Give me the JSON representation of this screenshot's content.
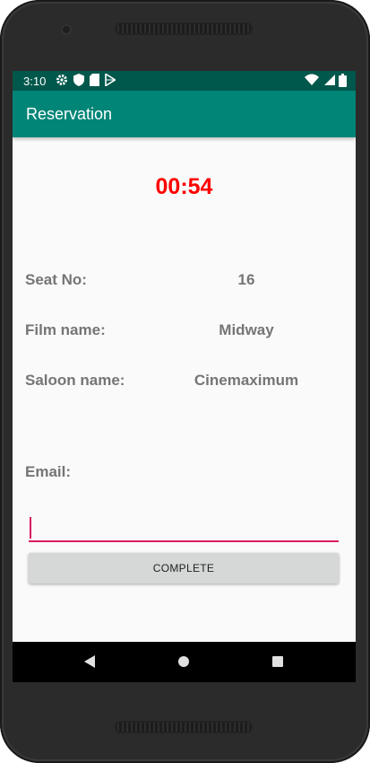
{
  "status_bar": {
    "time": "3:10",
    "icons": [
      "settings-icon",
      "shield-icon",
      "sd-card-icon",
      "play-store-icon"
    ],
    "right_icons": [
      "wifi-icon",
      "signal-icon",
      "battery-icon"
    ]
  },
  "app_bar": {
    "title": "Reservation"
  },
  "timer": {
    "value": "00:54",
    "color": "#ff0000"
  },
  "details": [
    {
      "label": "Seat No:",
      "value": "16"
    },
    {
      "label": "Film name:",
      "value": "Midway"
    },
    {
      "label": "Saloon name:",
      "value": "Cinemaximum"
    }
  ],
  "email": {
    "label": "Email:",
    "value": ""
  },
  "complete_button": {
    "label": "COMPLETE"
  },
  "nav_bar": {
    "icons": [
      "back-icon",
      "home-icon",
      "recents-icon"
    ]
  },
  "colors": {
    "primary": "#008577",
    "primary_dark": "#00574b",
    "accent": "#d81b60"
  }
}
